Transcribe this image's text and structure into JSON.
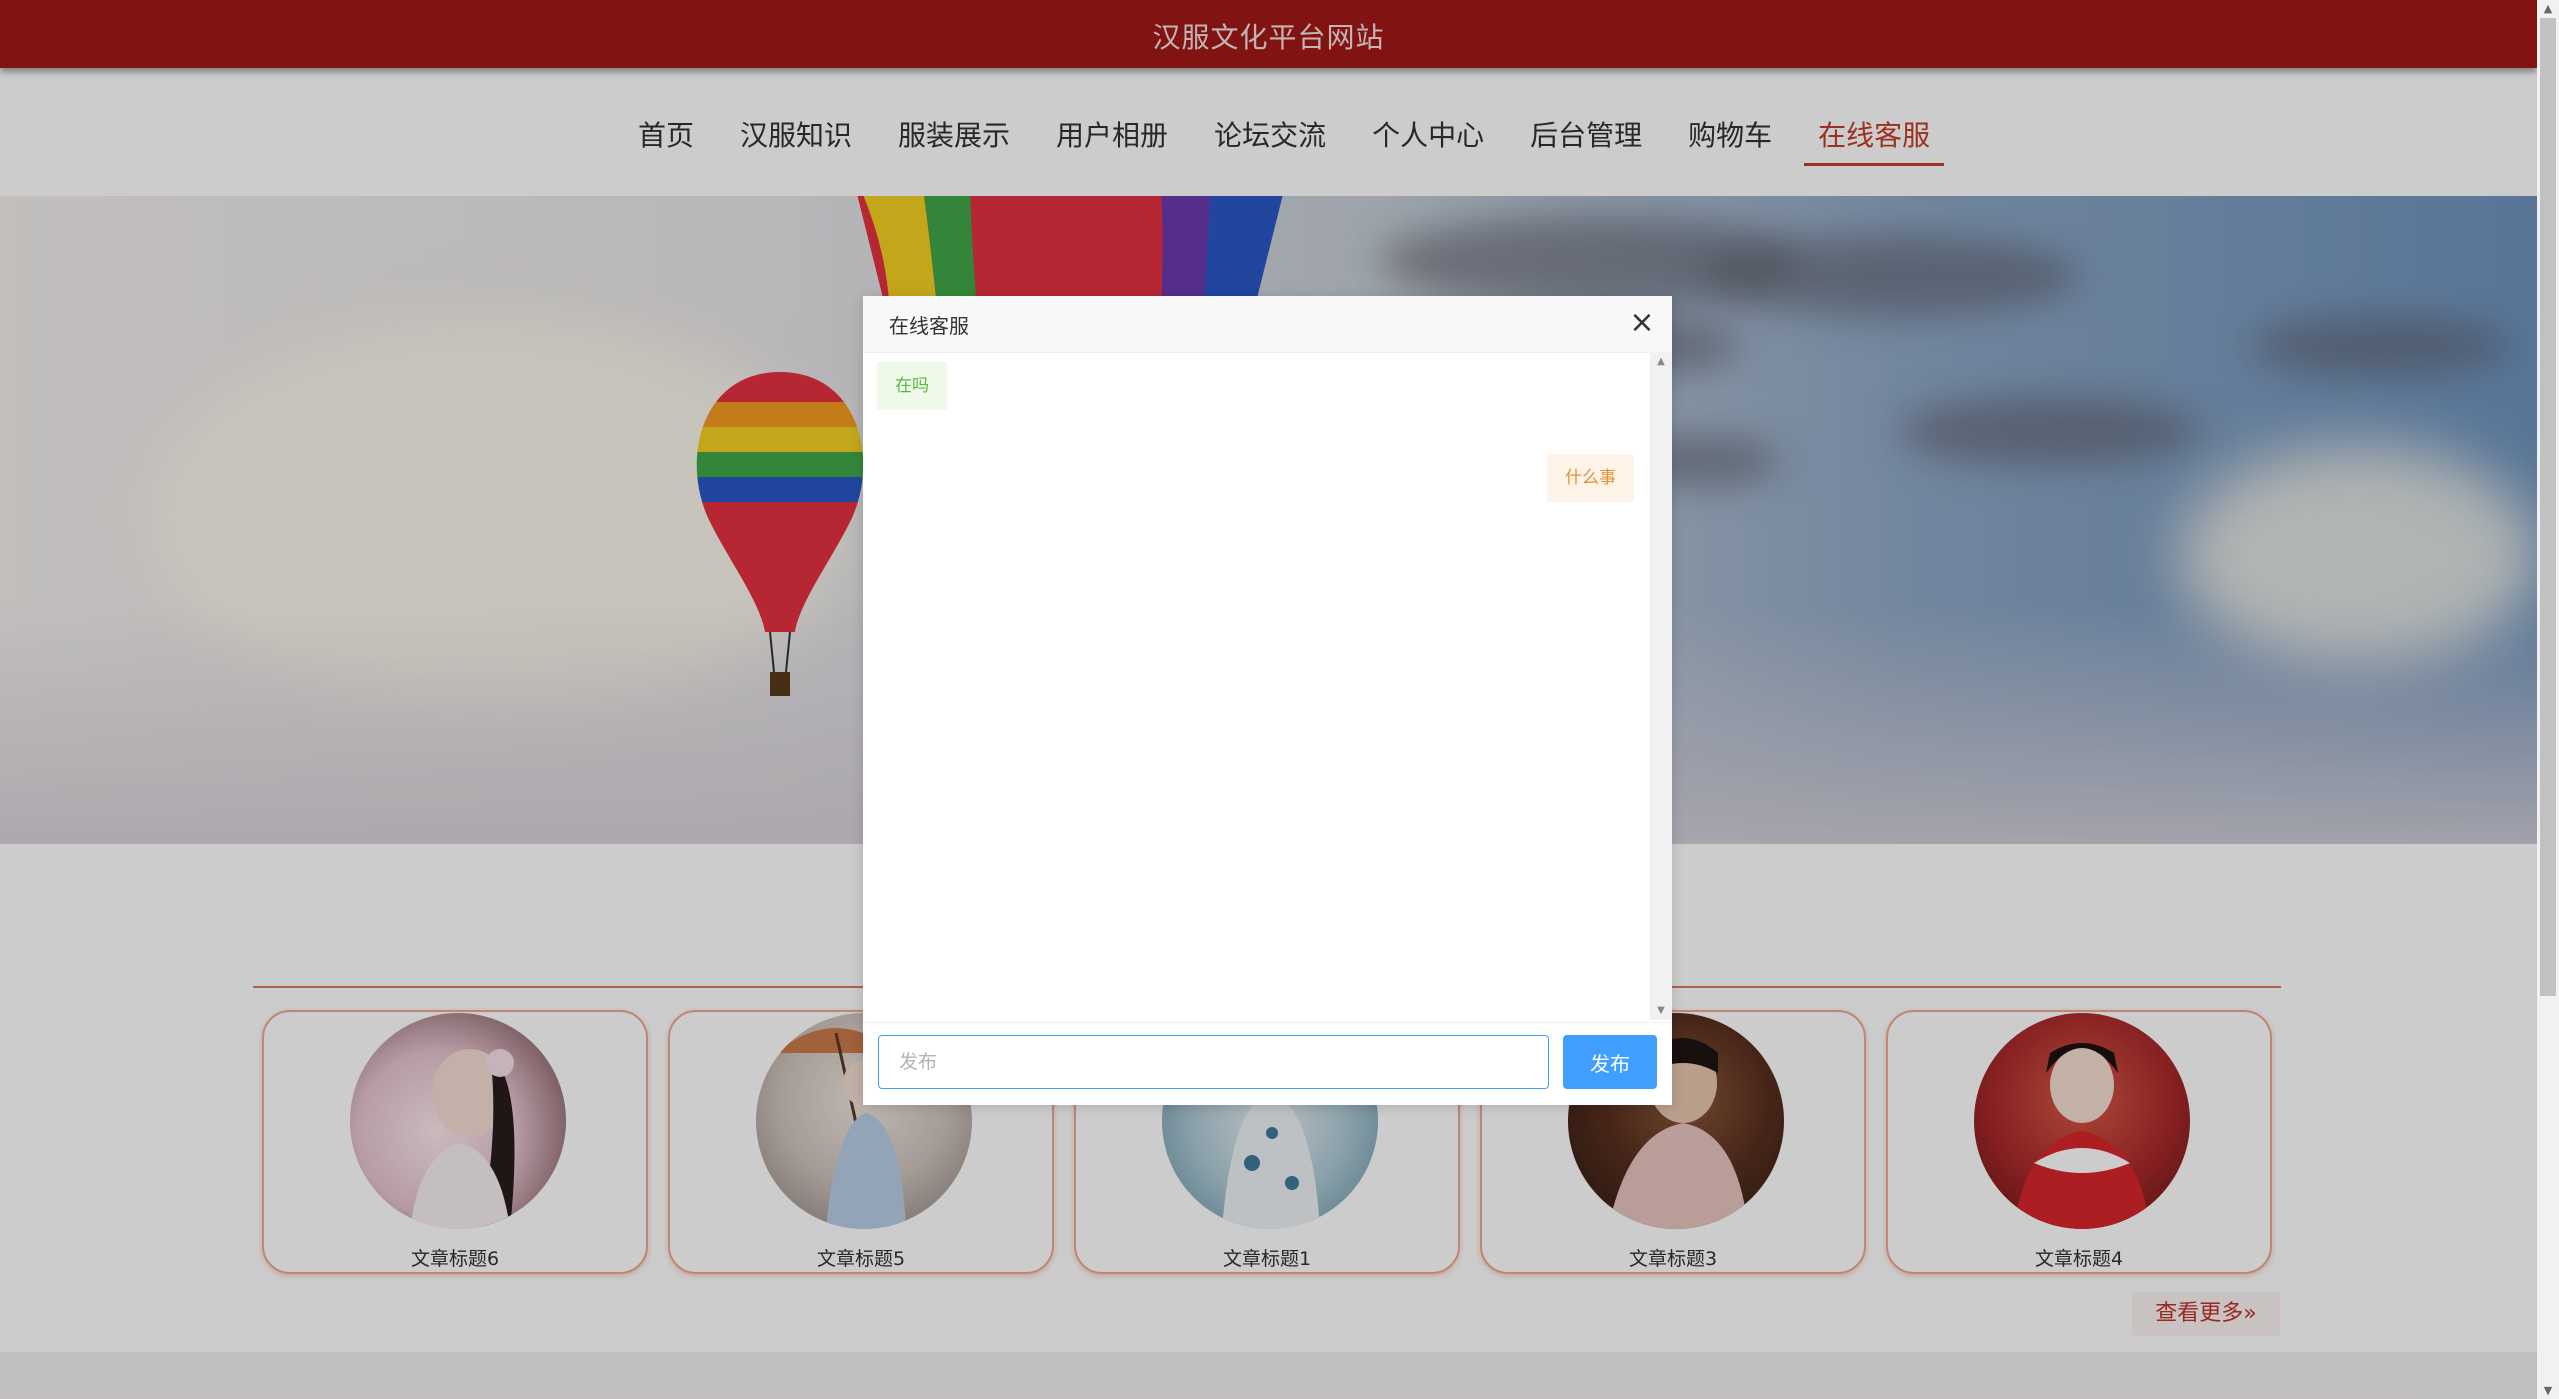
{
  "header": {
    "site_title": "汉服文化平台网站"
  },
  "nav": {
    "items": [
      {
        "label": "首页"
      },
      {
        "label": "汉服知识"
      },
      {
        "label": "服装展示"
      },
      {
        "label": "用户相册"
      },
      {
        "label": "论坛交流"
      },
      {
        "label": "个人中心"
      },
      {
        "label": "后台管理"
      },
      {
        "label": "购物车"
      },
      {
        "label": "在线客服"
      }
    ],
    "active": "在线客服",
    "active_color": "#c53d2a"
  },
  "articles": {
    "cards": [
      {
        "title": "文章标题6"
      },
      {
        "title": "文章标题5"
      },
      {
        "title": "文章标题1"
      },
      {
        "title": "文章标题3"
      },
      {
        "title": "文章标题4"
      }
    ],
    "more_label": "查看更多",
    "more_icon": "double-chevron-right-icon"
  },
  "dialog": {
    "title": "在线客服",
    "close_icon": "close-icon",
    "messages": [
      {
        "side": "left",
        "text": "在吗"
      },
      {
        "side": "right",
        "text": "什么事"
      }
    ],
    "input_placeholder": "发布",
    "input_value": "",
    "send_label": "发布"
  },
  "colors": {
    "header_bg": "#a31818",
    "accent": "#c53d2a",
    "primary_button": "#409eff"
  }
}
